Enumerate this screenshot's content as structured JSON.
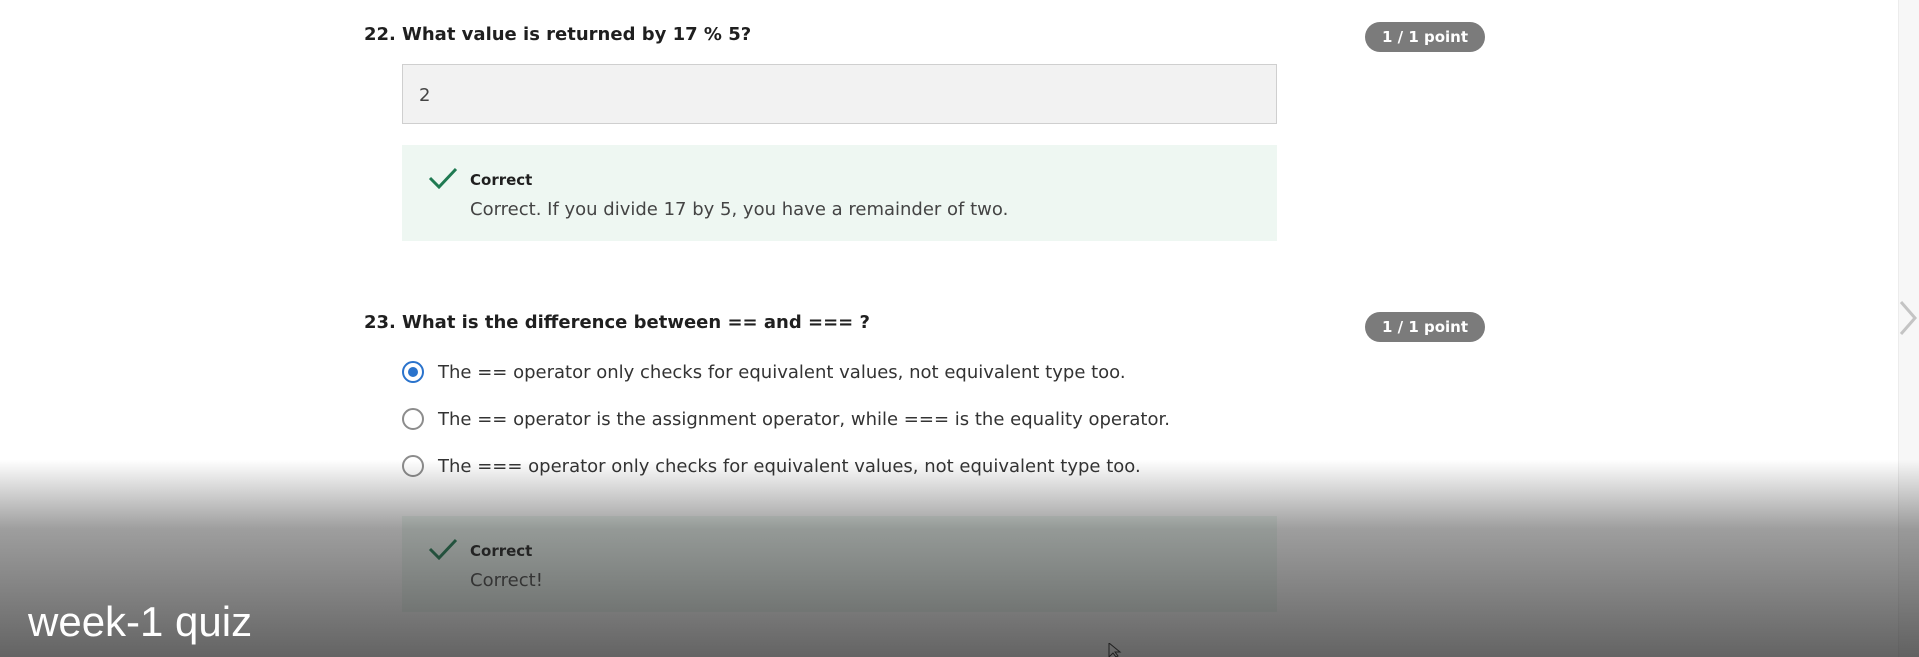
{
  "questions": [
    {
      "number": "22.",
      "text": "What value is returned by 17 % 5?",
      "points": "1 / 1 point",
      "answer_value": "2",
      "feedback": {
        "title": "Correct",
        "text": "Correct. If you divide 17 by 5, you have a remainder of two."
      }
    },
    {
      "number": "23.",
      "text": "What is the difference between == and === ?",
      "points": "1 / 1 point",
      "options": [
        {
          "label": "The == operator only checks for equivalent values, not equivalent type too.",
          "selected": true
        },
        {
          "label": "The == operator is the assignment operator, while === is the equality operator.",
          "selected": false
        },
        {
          "label": "The === operator only checks for equivalent values, not equivalent type too.",
          "selected": false
        }
      ],
      "feedback": {
        "title": "Correct",
        "text": "Correct!"
      }
    }
  ],
  "video": {
    "title": "week-1 quiz"
  },
  "colors": {
    "accent": "#2a73cc",
    "correct": "#1f7a52",
    "badge": "#7b7b7b",
    "feedback_bg": "#eef7f2"
  },
  "icons": [
    "check-icon",
    "chevron-right-icon",
    "radio-selected",
    "radio-unselected",
    "cursor-icon"
  ]
}
